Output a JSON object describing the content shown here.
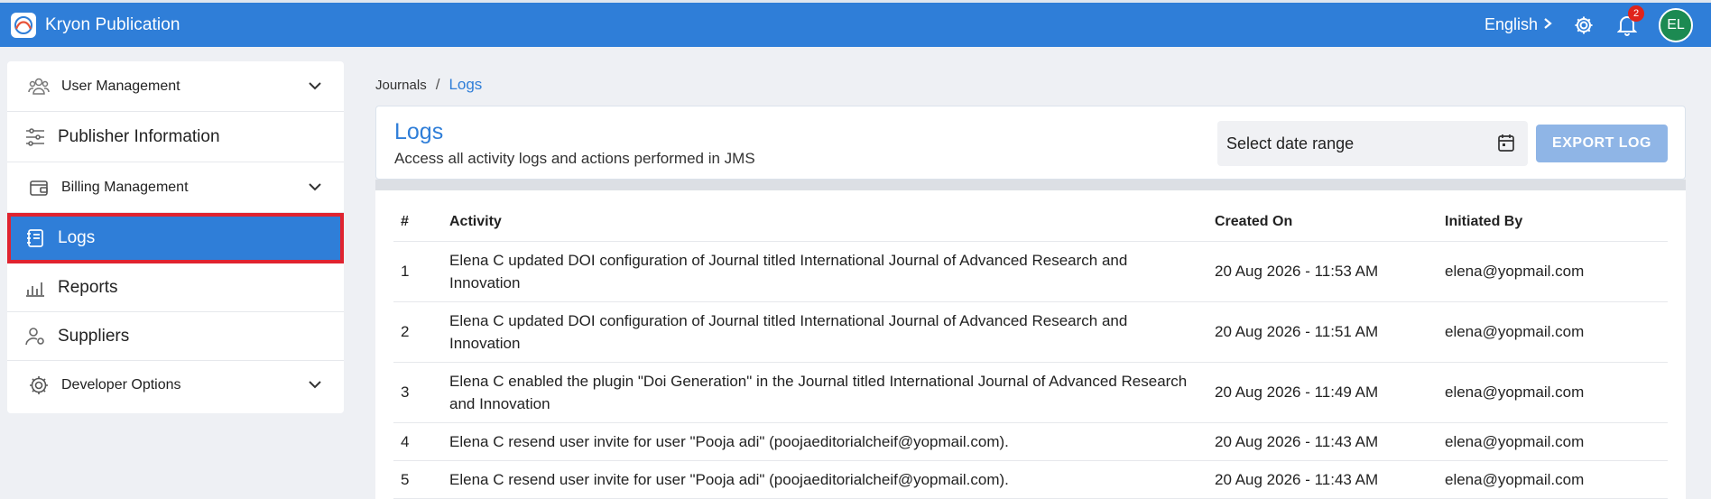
{
  "app": {
    "title": "Kryon Publication"
  },
  "topbar": {
    "language": "English",
    "notification_count": "2",
    "avatar_initials": "EL"
  },
  "sidebar": {
    "items": [
      {
        "label": "User Management"
      },
      {
        "label": "Publisher Information"
      },
      {
        "label": "Billing Management"
      },
      {
        "label": "Logs"
      },
      {
        "label": "Reports"
      },
      {
        "label": "Suppliers"
      },
      {
        "label": "Developer Options"
      }
    ]
  },
  "breadcrumb": {
    "parent": "Journals",
    "separator": "/",
    "current": "Logs"
  },
  "header": {
    "title": "Logs",
    "subtitle": "Access all activity logs and actions performed in JMS",
    "date_placeholder": "Select date range",
    "export_label": "EXPORT LOG"
  },
  "table": {
    "columns": [
      "#",
      "Activity",
      "Created On",
      "Initiated By"
    ],
    "rows": [
      {
        "num": "1",
        "activity": "Elena C updated DOI configuration of Journal titled International Journal of Advanced Research and Innovation",
        "created": "20 Aug 2026 - 11:53 AM",
        "by": "elena@yopmail.com"
      },
      {
        "num": "2",
        "activity": "Elena C updated DOI configuration of Journal titled International Journal of Advanced Research and Innovation",
        "created": "20 Aug 2026 - 11:51 AM",
        "by": "elena@yopmail.com"
      },
      {
        "num": "3",
        "activity": "Elena C enabled the plugin \"Doi Generation\" in the Journal titled International Journal of Advanced Research and Innovation",
        "created": "20 Aug 2026 - 11:49 AM",
        "by": "elena@yopmail.com"
      },
      {
        "num": "4",
        "activity": "Elena C resend user invite for user \"Pooja adi\" (poojaeditorialcheif@yopmail.com).",
        "created": "20 Aug 2026 - 11:43 AM",
        "by": "elena@yopmail.com"
      },
      {
        "num": "5",
        "activity": "Elena C resend user invite for user \"Pooja adi\" (poojaeditorialcheif@yopmail.com).",
        "created": "20 Aug 2026 - 11:43 AM",
        "by": "elena@yopmail.com"
      }
    ]
  },
  "colors": {
    "primary": "#2f7ed8",
    "highlight_border": "#e0232f",
    "badge": "#e0241b",
    "avatar_bg": "#1c8a52",
    "export_disabled": "#8fb5e6"
  }
}
